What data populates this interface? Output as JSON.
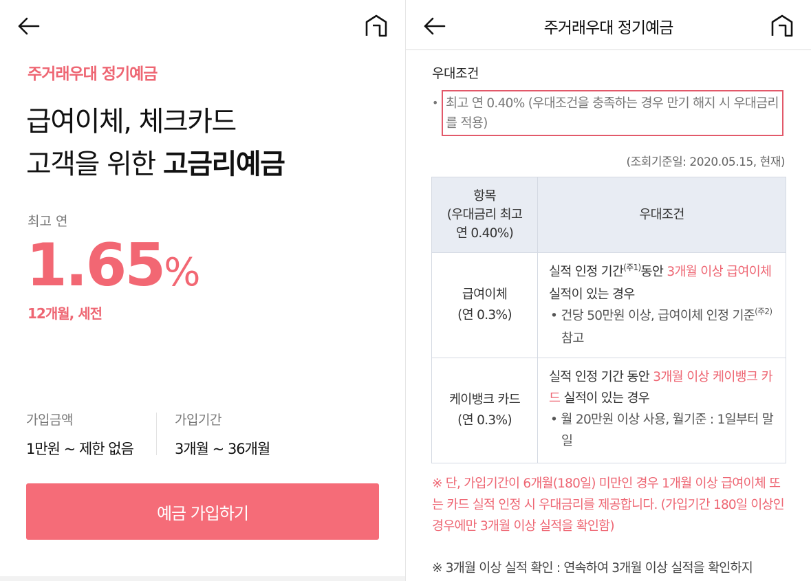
{
  "left": {
    "eyebrow": "주거래우대 정기예금",
    "headline_line1": "급여이체, 체크카드",
    "headline_line2_prefix": "고객을 위한 ",
    "headline_line2_bold": "고금리예금",
    "rate_caption": "최고 연",
    "rate_value": "1.65",
    "rate_unit": "%",
    "rate_note": "12개월, 세전",
    "amount_label": "가입금액",
    "amount_value": "1만원 ~ 제한 없음",
    "period_label": "가입기간",
    "period_value": "3개월 ~ 36개월",
    "join_button": "예금 가입하기"
  },
  "right": {
    "title": "주거래우대 정기예금",
    "section_title": "우대조건",
    "bullet": "•",
    "highlight_text": "최고 연 0.40% (우대조건을 충족하는 경우 만기 해지 시 우대금리를 적용)",
    "ref_date": "(조회기준일: 2020.05.15, 현재)",
    "table": {
      "head_item_line1": "항목",
      "head_item_line2": "(우대금리 최고",
      "head_item_line3": "연 0.40%)",
      "head_condition": "우대조건",
      "row1": {
        "item_line1": "급여이체",
        "item_line2": "(연 0.3%)",
        "desc_a": "실적 인정 기간",
        "desc_sup": "(주1)",
        "desc_b": "동안 ",
        "desc_pink": "3개월 이상 급여이체",
        "desc_c": " 실적이 있는 경우",
        "note_a": "• 건당 50만원 이상, 급여이체 인정 기준",
        "note_sup": "(주2)",
        "note_b": " 참고"
      },
      "row2": {
        "item_line1": "케이뱅크 카드",
        "item_line2": "(연 0.3%)",
        "desc_a": "실적 인정 기간 동안 ",
        "desc_pink": "3개월 이상 케이뱅크 카드",
        "desc_c": " 실적이 있는 경우",
        "note": "• 월 20만원 이상 사용, 월기준 : 1일부터 말일"
      }
    },
    "warn1": "※ 단, 가입기간이 6개월(180일) 미만인 경우 1개월 이상 급여이체 또는 카드 실적 인정 시 우대금리를 제공합니다. (가입기간 180일 이상인 경우에만 3개월 이상 실적을 확인함)",
    "warn2": "※ 3개월 이상 실적 확인 : 연속하여 3개월 이상 실적을 확인하지"
  },
  "icons": {
    "back": "back-arrow-icon",
    "home": "home-icon"
  },
  "colors": {
    "accent": "#f56c78",
    "highlight_border": "#e2596a",
    "table_header_bg": "#e8ecf3"
  }
}
